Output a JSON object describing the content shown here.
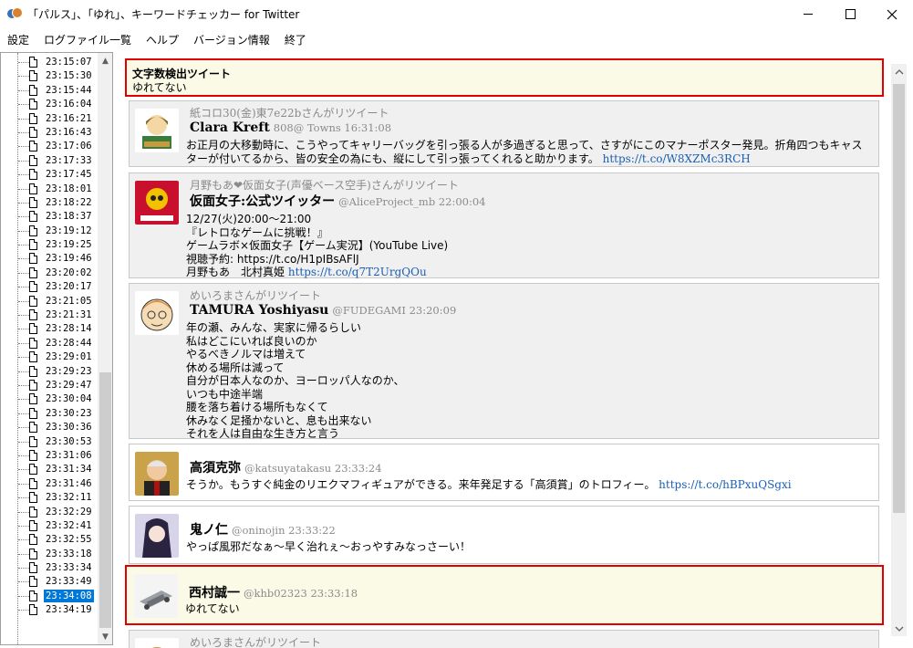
{
  "window": {
    "title": "「パルス」、「ゆれ」、キーワードチェッカー for Twitter"
  },
  "menu": [
    "設定",
    "ログファイル一覧",
    "ヘルプ",
    "バージョン情報",
    "終了"
  ],
  "tree": {
    "items": [
      "23:15:07",
      "23:15:30",
      "23:15:44",
      "23:16:04",
      "23:16:21",
      "23:16:43",
      "23:17:06",
      "23:17:33",
      "23:17:45",
      "23:18:01",
      "23:18:22",
      "23:18:37",
      "23:19:12",
      "23:19:25",
      "23:19:46",
      "23:20:02",
      "23:20:17",
      "23:21:05",
      "23:21:31",
      "23:28:14",
      "23:28:44",
      "23:29:01",
      "23:29:23",
      "23:29:47",
      "23:30:04",
      "23:30:23",
      "23:30:36",
      "23:30:53",
      "23:31:06",
      "23:31:34",
      "23:31:46",
      "23:32:11",
      "23:32:29",
      "23:32:41",
      "23:32:55",
      "23:33:18",
      "23:33:34",
      "23:33:49",
      "23:34:08",
      "23:34:19"
    ],
    "selected_index": 38
  },
  "feed": {
    "detected": {
      "header": "文字数検出ツイート",
      "text": "ゆれてない"
    },
    "tweets": [
      {
        "retweet_by": "紙コロ30(金)東7e22bさんがリツイート",
        "name": "Clara Kreft",
        "meta": "808@ Towns 16:31:08",
        "body": "お正月の大移動時に、こうやってキャリーバッグを引っ張る人が多過ぎると思って、さすがにこのマナーポスター発見。折角四つもキャスターが付いてるから、皆の安全の為にも、縦にして引っ張ってくれると助かります。",
        "link": "https://t.co/W8XZMc3RCH"
      },
      {
        "retweet_by": "月野もあ❤仮面女子(声優ベース空手)さんがリツイート",
        "name": "仮面女子:公式ツイッター",
        "meta": "@AliceProject_mb 22:00:04",
        "body": "12/27(火)20:00～21:00\n『レトロなゲームに挑戦！』\nゲームラボ×仮面女子【ゲーム実況】(YouTube Live)\n視聴予約: https://t.co/H1pIBsAFlJ\n月野もあ　北村真姫",
        "link": "https://t.co/q7T2UrgQOu"
      },
      {
        "retweet_by": "めいろまさんがリツイート",
        "name": "TAMURA Yoshiyasu",
        "meta": "@FUDEGAMI 23:20:09",
        "body": "年の瀬、みんな、実家に帰るらしい\n私はどこにいれば良いのか\nやるべきノルマは増えて\n休める場所は減って\n自分が日本人なのか、ヨーロッパ人なのか、\nいつも中途半端\n腰を落ち着ける場所もなくて\n休みなく足掻かないと、息も出来ない\nそれを人は自由な生き方と言う",
        "link": ""
      },
      {
        "retweet_by": "",
        "name": "高須克弥",
        "meta": "@katsuyatakasu 23:33:24",
        "body": "そうか。もうすぐ純金のリエクマフィギュアができる。来年発足する「高須賞」のトロフィー。",
        "link": "https://t.co/hBPxuQSgxi"
      },
      {
        "retweet_by": "",
        "name": "鬼ノ仁",
        "meta": "@oninojin 23:33:22",
        "body": "やっぱ風邪だなぁ～早く治れぇ～おっやすみなっさーい！",
        "link": ""
      },
      {
        "retweet_by": "",
        "name": "西村誠一",
        "meta": "@khb02323 23:33:18",
        "body": "ゆれてない",
        "link": ""
      }
    ],
    "partial_retweet_by": "めいろまさんがリツイート"
  },
  "icons": {
    "min": "minimize-icon",
    "max": "maximize-icon",
    "close": "close-icon",
    "up": "arrow-up-icon",
    "down": "arrow-down-icon"
  },
  "colors": {
    "highlight_border": "#e00000",
    "highlight_bg": "#fafae6",
    "selection": "#0078d7",
    "link": "#1a5fb4"
  }
}
